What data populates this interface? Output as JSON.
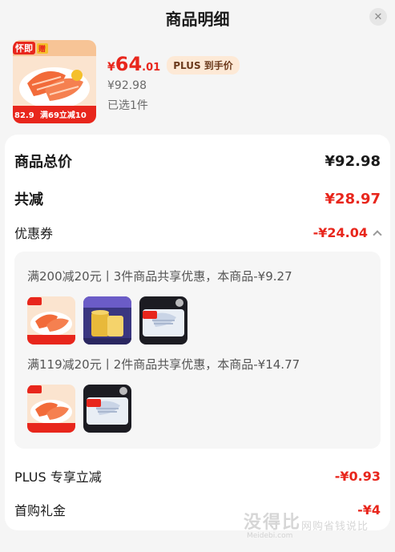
{
  "header": {
    "title": "商品明细",
    "close_label": "✕"
  },
  "product": {
    "price_currency": "¥",
    "price_integer": "64",
    "price_decimal": ".01",
    "plus_tag": "PLUS 到手价",
    "original_price": "¥92.98",
    "selected_count": "已选1件",
    "thumb_badges": {
      "top_left": "怀即",
      "top_right": "赠",
      "banner": "满69立减10",
      "price_hint": "82.9"
    }
  },
  "summary": {
    "total_label": "商品总价",
    "total_value": "¥92.98",
    "discount_label": "共减",
    "discount_value": "¥28.97",
    "coupon_label": "优惠券",
    "coupon_value": "-¥24.04"
  },
  "coupon_groups": [
    {
      "text": "满200减20元丨3件商品共享优惠，本商品-¥9.27"
    },
    {
      "text": "满119减20元丨2件商品共享优惠，本商品-¥14.77"
    }
  ],
  "other_discounts": {
    "plus_label": "PLUS 专享立减",
    "plus_value": "-¥0.93",
    "first_label": "首购礼金",
    "first_value": "-¥4"
  },
  "watermark": {
    "text": "没得比",
    "sub": "网购省钱说比",
    "url": "Meidebi.com"
  },
  "colors": {
    "accent": "#e8261c",
    "plus_tag_bg": "#fde9d6",
    "text": "#1a1a1a",
    "muted": "#6b6b6b"
  }
}
